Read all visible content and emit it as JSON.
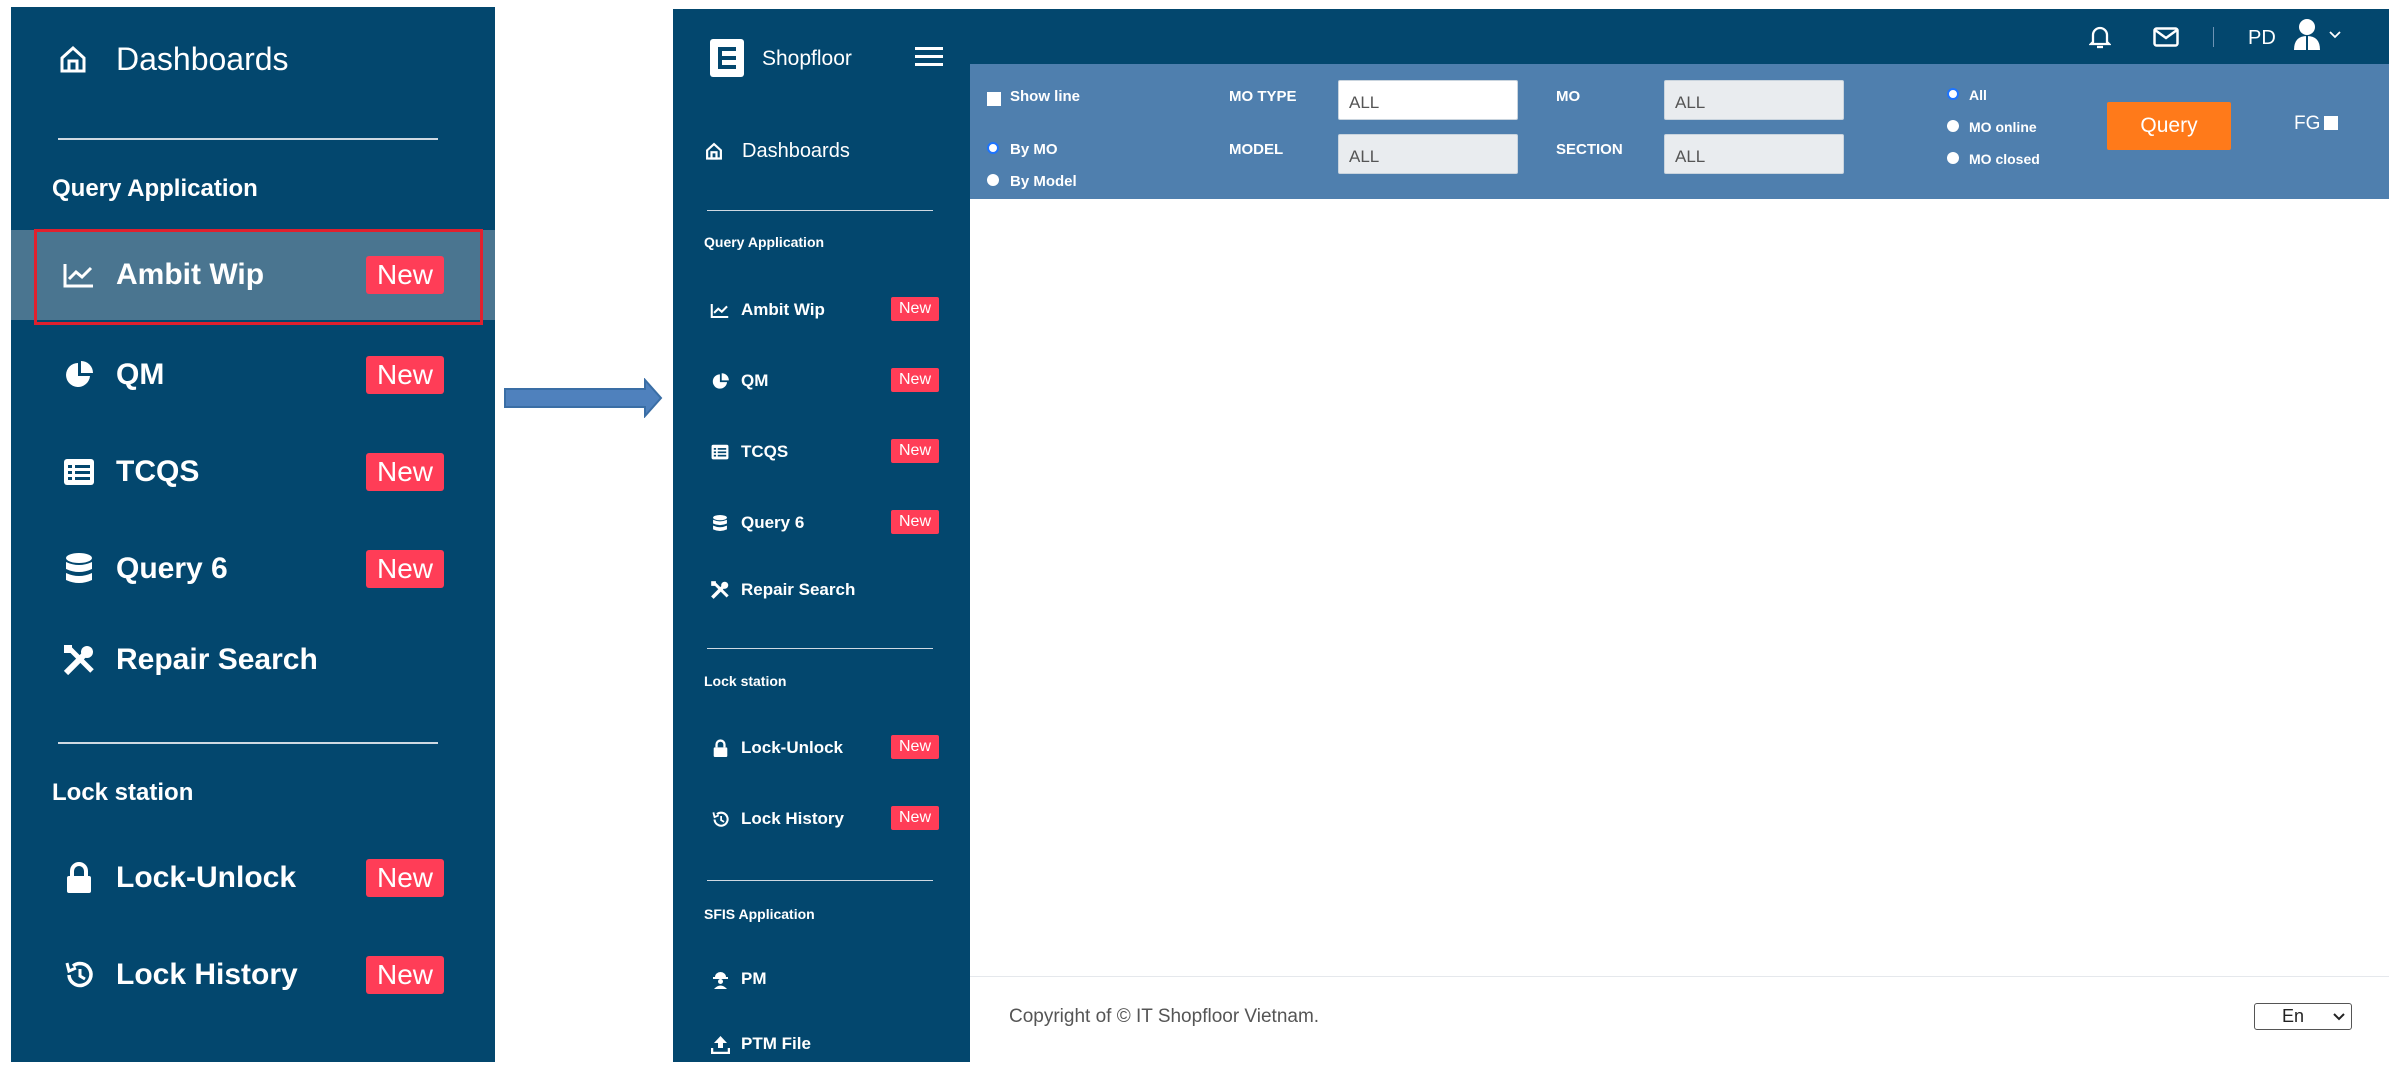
{
  "zoom_sidebar": {
    "dashboards_label": "Dashboards",
    "query_section": "Query Application",
    "items": [
      {
        "label": "Ambit Wip",
        "badge": "New",
        "icon": "chart-line-icon"
      },
      {
        "label": "QM",
        "badge": "New",
        "icon": "pie-chart-icon"
      },
      {
        "label": "TCQS",
        "badge": "New",
        "icon": "list-icon"
      },
      {
        "label": "Query 6",
        "badge": "New",
        "icon": "database-icon"
      },
      {
        "label": "Repair Search",
        "icon": "tools-icon"
      }
    ],
    "lock_section": "Lock station",
    "lock_items": [
      {
        "label": "Lock-Unlock",
        "badge": "New",
        "icon": "lock-icon"
      },
      {
        "label": "Lock History",
        "badge": "New",
        "icon": "history-icon"
      }
    ]
  },
  "app": {
    "brand": "Shopfloor",
    "dashboards_label": "Dashboards",
    "query_section": "Query Application",
    "items": [
      {
        "label": "Ambit Wip",
        "badge": "New"
      },
      {
        "label": "QM",
        "badge": "New"
      },
      {
        "label": "TCQS",
        "badge": "New"
      },
      {
        "label": "Query 6",
        "badge": "New"
      },
      {
        "label": "Repair Search"
      }
    ],
    "lock_section": "Lock station",
    "lock_items": [
      {
        "label": "Lock-Unlock",
        "badge": "New"
      },
      {
        "label": "Lock History",
        "badge": "New"
      }
    ],
    "sfis_section": "SFIS Application",
    "sfis_items": [
      {
        "label": "PM"
      },
      {
        "label": "PTM File"
      }
    ],
    "user": "PD"
  },
  "filters": {
    "show_line": "Show line",
    "by_mo": "By MO",
    "by_model": "By Model",
    "mo_type_label": "MO TYPE",
    "mo_type_value": "ALL",
    "model_label": "MODEL",
    "model_value": "ALL",
    "mo_label": "MO",
    "mo_value": "ALL",
    "section_label": "SECTION",
    "section_value": "ALL",
    "status_all": "All",
    "status_online": "MO online",
    "status_closed": "MO closed",
    "query_button": "Query",
    "fg_label": "FG"
  },
  "footer": {
    "copyright": "Copyright of © IT Shopfloor Vietnam.",
    "language": "En"
  },
  "colors": {
    "sidebar_bg": "#03476e",
    "filter_bg": "#4f7fae",
    "badge": "#ff3d57",
    "query_button": "#ff7a1a",
    "highlight_box": "#e0202e"
  }
}
